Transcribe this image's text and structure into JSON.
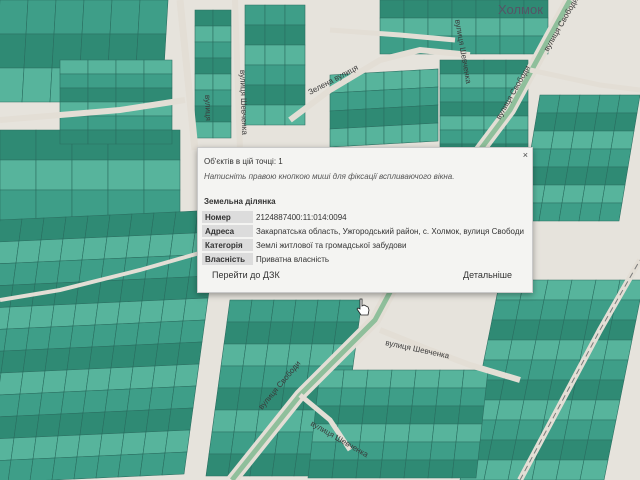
{
  "map": {
    "town_label": "Холмок",
    "streets": [
      "Зелена вулиця",
      "вулиця Свободи",
      "вулиця Свободи",
      "вулиця Шевченка",
      "вулиця Шевченка",
      "вулиця Свободи",
      "вулиця Шевченка",
      "вулиця",
      "вулиця Шевченка"
    ],
    "colors": {
      "parcel": "#3e9e88",
      "parcel_dark": "#2f8a74",
      "parcel_light": "#57b49c",
      "road": "#e3ded5",
      "highway": "#8fbf9b"
    }
  },
  "popup": {
    "count_text": "Об'єктів в цій точці: 1",
    "hint_text": "Натисніть правою кнопкою миші для фіксації вспливаючого вікна.",
    "section_title": "Земельна ділянка",
    "rows": [
      {
        "key": "Номер",
        "value": "2124887400:11:014:0094"
      },
      {
        "key": "Адреса",
        "value": "Закарпатська область, Ужгородський район, с. Холмок, вулиця Свободи"
      },
      {
        "key": "Категорія",
        "value": "Землі житлової та громадської забудови"
      },
      {
        "key": "Власність",
        "value": "Приватна власність"
      }
    ],
    "link_dzk": "Перейти до ДЗК",
    "link_details": "Детальніше",
    "close_label": "×"
  }
}
